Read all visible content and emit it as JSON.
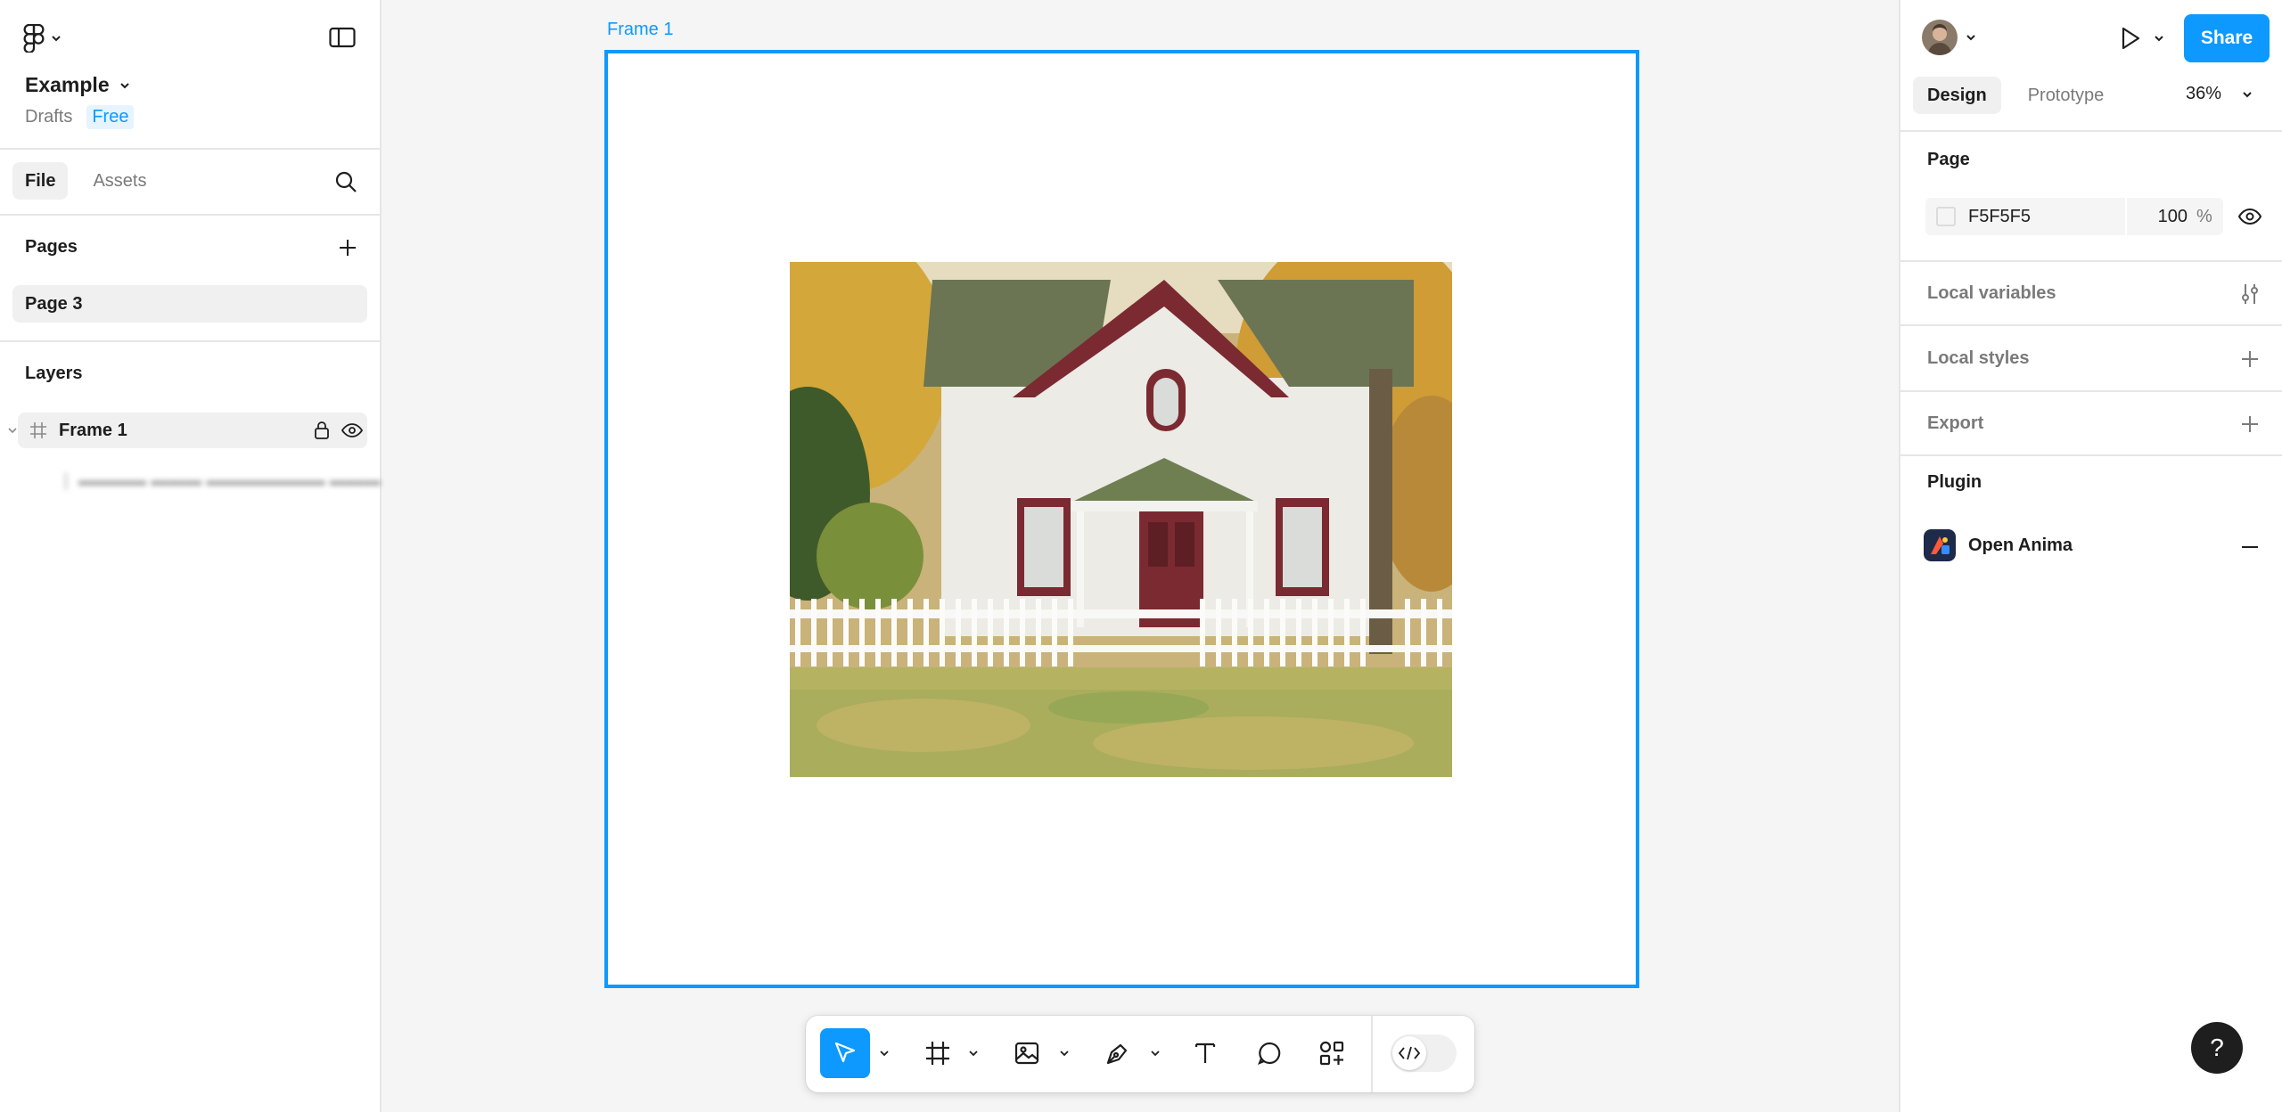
{
  "app": {
    "logo_icon": "figma-logo-icon",
    "file_name": "Example",
    "location": "Drafts",
    "plan": "Free"
  },
  "left_panel": {
    "tabs": [
      {
        "label": "File",
        "active": true
      },
      {
        "label": "Assets",
        "active": false
      }
    ],
    "pages_title": "Pages",
    "pages": [
      {
        "label": "Page 3",
        "active": true
      }
    ],
    "layers_title": "Layers",
    "layers": [
      {
        "label": "Frame 1",
        "icon": "frame-icon"
      }
    ]
  },
  "canvas": {
    "frame_label": "Frame 1",
    "frame_image": "house-photo"
  },
  "toolbar": {
    "tools": [
      {
        "name": "move-tool",
        "icon": "cursor-icon",
        "active": true
      },
      {
        "name": "frame-tool",
        "icon": "frame-icon"
      },
      {
        "name": "image-tool",
        "icon": "image-icon"
      },
      {
        "name": "pen-tool",
        "icon": "pen-icon"
      },
      {
        "name": "text-tool",
        "icon": "text-icon"
      },
      {
        "name": "comment-tool",
        "icon": "comment-icon"
      },
      {
        "name": "actions-tool",
        "icon": "actions-icon"
      }
    ],
    "dev_mode_icon": "code-icon"
  },
  "right_panel": {
    "share_label": "Share",
    "tabs": [
      {
        "label": "Design",
        "active": true
      },
      {
        "label": "Prototype",
        "active": false
      }
    ],
    "zoom": "36%",
    "page_section": {
      "title": "Page",
      "color_hex": "F5F5F5",
      "opacity": "100",
      "percent_symbol": "%"
    },
    "local_variables": "Local variables",
    "local_styles": "Local styles",
    "export": "Export",
    "plugin_title": "Plugin",
    "plugin_name": "Open Anima"
  },
  "help_label": "?",
  "colors": {
    "accent": "#0d99ff",
    "panel_bg": "#ffffff",
    "canvas_bg": "#f5f5f5",
    "active_row": "#f0f0f0"
  }
}
